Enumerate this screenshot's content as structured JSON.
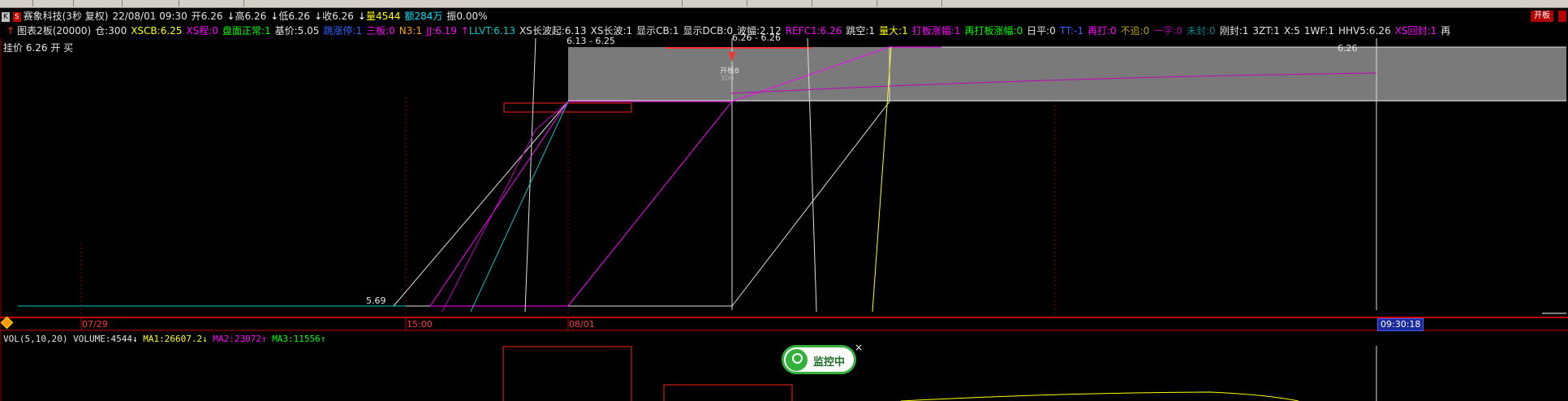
{
  "header": {
    "k_label": "K",
    "s_label": "S",
    "title": "赛象科技(3秒 复权)",
    "datetime": "22/08/01 09:30",
    "open": "开6.26",
    "high": "高6.26",
    "low": "低6.26",
    "close": "收6.26",
    "volume": "量4544",
    "amount": "额284万",
    "amplitude": "振0.00%",
    "right_button": "开板"
  },
  "indicators": {
    "chart_name": "图表2板(20000)",
    "position": "仓:300",
    "xscb": "XSCB:6.25",
    "xs_rise": "XS程:0",
    "market": "盘面正常:1",
    "base_price": "基价:5.05",
    "lianban": "跳涨停:1",
    "sanban": "三板:0",
    "n3": "N3:1",
    "jj": "JJ:6.19",
    "llvt": "LLVT:6.13",
    "xs_wave_start": "XS长波起:6.13",
    "xs_wave": "XS长波:1",
    "show_cb": "显示CB:1",
    "show_dcb": "显示DCB:0",
    "wave_amp": "波幅:2.12",
    "refc1": "REFC1:6.26",
    "jump_empty": "跳空:1",
    "big_vol": "量大:1",
    "board_amp": "打板涨幅:1",
    "reboard_amp": "再打板涨幅:0",
    "flat": "日平:0",
    "tt": "TT:-1",
    "re_hit": "再打:0",
    "no_chase": "不追:0",
    "one_word": "一字:0",
    "unsealed": "未封:0",
    "just_sealed": "刚封:1",
    "zt3": "3ZT:1",
    "x5": "X:5",
    "wf1": "1WF:1",
    "hhv5": "HHV5:6.26",
    "xs_return": "XS回封:1",
    "tail": "再"
  },
  "order_line": "挂价 6.26 开 买",
  "price_annotations": {
    "range_top": "6.13 - 6.25",
    "range_top2": "6.26 - 6.26",
    "label_open_board": "开板8",
    "label_300": "300",
    "right_price": "6.26",
    "low_price": "5.69"
  },
  "time_axis": {
    "labels": [
      "07/29",
      "15:00",
      "08/01"
    ],
    "current_time": "09:30:18"
  },
  "volume_panel": {
    "title": "VOL(5,10,20)",
    "volume": "VOLUME:4544",
    "ma1": "MA1:26607.2",
    "ma2": "MA2:23072",
    "ma3": "MA3:11556"
  },
  "monitor_badge": {
    "label": "监控中",
    "close": "×"
  },
  "colors": {
    "background": "#000000",
    "gray_band": "#808080",
    "grid_red": "#8b0000",
    "magenta": "#ff00ff",
    "yellow": "#ffff00",
    "cyan": "#00c8c8",
    "white": "#e0e0e0"
  }
}
